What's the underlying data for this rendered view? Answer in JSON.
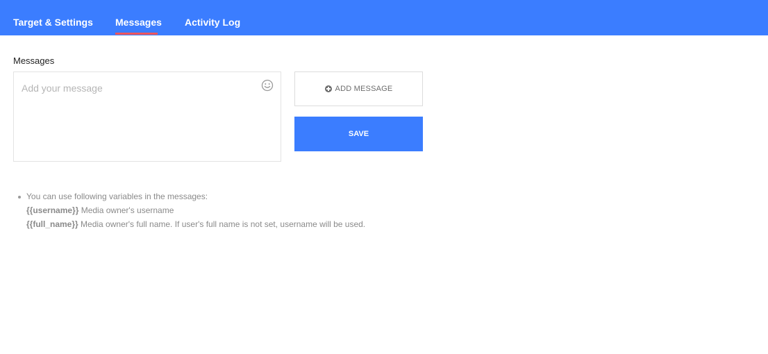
{
  "tabs": [
    {
      "label": "Target & Settings",
      "active": false
    },
    {
      "label": "Messages",
      "active": true
    },
    {
      "label": "Activity Log",
      "active": false
    }
  ],
  "colors": {
    "header": "#3b7dff",
    "active_underline": "#f0555a",
    "save_button": "#3b7dff"
  },
  "messages": {
    "section_label": "Messages",
    "input_value": "",
    "input_placeholder": "Add your message",
    "emoji_icon": "smiley-icon",
    "add_button_icon": "plus-circle-icon",
    "add_button_label": "ADD MESSAGE",
    "save_button_label": "SAVE"
  },
  "help": {
    "intro": "You can use following variables in the messages:",
    "variables": [
      {
        "name": "{{username}}",
        "description": " Media owner's username"
      },
      {
        "name": "{{full_name}}",
        "description": " Media owner's full name. If user's full name is not set, username will be used."
      }
    ]
  }
}
